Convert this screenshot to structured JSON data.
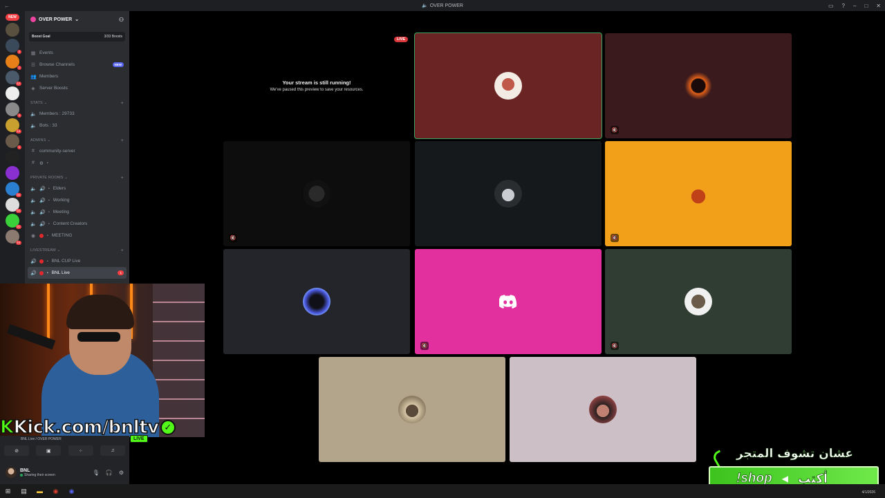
{
  "window": {
    "title": "OVER POWER"
  },
  "rail": {
    "new_badge": "NEW",
    "badges": [
      "2",
      "1",
      "12",
      "4",
      "13",
      "1",
      "34",
      "24",
      "21",
      "10"
    ]
  },
  "guild": {
    "name": "OVER POWER"
  },
  "boost": {
    "label": "Boost Goal",
    "progress": "3/33 Boosts"
  },
  "nav": [
    {
      "label": "Events",
      "icon": "calendar-icon"
    },
    {
      "label": "Browse Channels",
      "icon": "browse-icon",
      "badge": "NEW"
    },
    {
      "label": "Members",
      "icon": "members-icon"
    },
    {
      "label": "Server Boosts",
      "icon": "boost-icon"
    }
  ],
  "categories": {
    "stats": "STATS",
    "admins": "ADMINS",
    "private": "PRIVATE ROOMS",
    "livestream": "LIVESTREAM"
  },
  "stats_channels": [
    "Members : 29733",
    "Bots : 33"
  ],
  "admin_channels": [
    "community-server"
  ],
  "private_channels": [
    "Elders",
    "Working",
    "Meeting",
    "Content Creators",
    "MEETING"
  ],
  "live_channels": [
    "BNL CUP Live",
    "BNL Live"
  ],
  "active_mention": "1",
  "stage": {
    "live_pill": "LIVE",
    "paused_title": "Your stream is still running!",
    "paused_sub": "We've paused this preview to save your resources."
  },
  "voice": {
    "status": "BNL Live / OVER POWER"
  },
  "user": {
    "name": "BNL",
    "status": "Sharing their screen"
  },
  "overlay": {
    "kick_k": "K",
    "kick_rest": "Kick.com/bnltv",
    "kick_live": "LIVE",
    "shop_arabic": "عشان تشوف المتجر",
    "shop_write": "أكتب",
    "shop_cmd": "!shop"
  },
  "taskbar": {
    "date": "4/1/2026"
  },
  "colors": {
    "tile_maroon": "#6b2424",
    "tile_dark_red": "#3a1a1c",
    "tile_black": "#0d0d0e",
    "tile_charcoal": "#16191c",
    "tile_orange": "#f2a01a",
    "tile_slate": "#24252a",
    "tile_pink": "#e2319f",
    "tile_green": "#2f3d32",
    "tile_beige": "#b3a48c",
    "tile_lilac": "#cdbfc6",
    "kick_green": "#53fc18",
    "live_red": "#da373c"
  }
}
